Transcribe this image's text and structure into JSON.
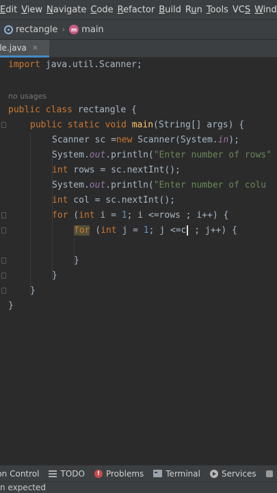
{
  "menu": {
    "items": [
      {
        "prefix": "",
        "u": "E",
        "rest": "dit"
      },
      {
        "prefix": "",
        "u": "V",
        "rest": "iew"
      },
      {
        "prefix": "",
        "u": "N",
        "rest": "avigate"
      },
      {
        "prefix": "",
        "u": "C",
        "rest": "ode"
      },
      {
        "prefix": "",
        "u": "R",
        "rest": "efactor"
      },
      {
        "prefix": "",
        "u": "B",
        "rest": "uild"
      },
      {
        "prefix": "R",
        "u": "u",
        "rest": "n"
      },
      {
        "prefix": "",
        "u": "T",
        "rest": "ools"
      },
      {
        "prefix": "VC",
        "u": "S",
        "rest": ""
      },
      {
        "prefix": "",
        "u": "W",
        "rest": "ind"
      }
    ]
  },
  "navbar": {
    "project": "rectangle",
    "branch": "main",
    "branch_badge": "m"
  },
  "tab": {
    "label": "ngle.java",
    "close": "×"
  },
  "editor": {
    "usage_hint": "no usages",
    "lines": {
      "import_kw": "import",
      "import_rest": " java.util.Scanner;",
      "l_class_public": "public",
      "l_class_class": " class",
      "l_class_rest": " rectangle {",
      "l_main_mods": "public static void",
      "l_main_name": " main",
      "l_main_rest": "(String[] args) {",
      "l_scan_a": "Scanner sc =",
      "l_scan_new": "new",
      "l_scan_b": " Scanner(System.",
      "l_scan_in": "in",
      "l_scan_c": ");",
      "l_p1_a": "System.",
      "l_p1_out": "out",
      "l_p1_b": ".println(",
      "l_p1_str": "\"Enter number of rows\"",
      "l_rows_int": "int",
      "l_rows_rest": " rows = sc.nextInt();",
      "l_p2_a": "System.",
      "l_p2_out": "out",
      "l_p2_b": ".println(",
      "l_p2_str": "\"Enter number of colu",
      "l_col_int": "int",
      "l_col_rest": " col = sc.nextInt();",
      "l_for1_for": "for",
      "l_for1_a": " (",
      "l_for1_int": "int",
      "l_for1_b": " i = ",
      "l_for1_num": "1",
      "l_for1_c": "; i <=rows ; i++) {",
      "l_for2_for": "for",
      "l_for2_a": " (",
      "l_for2_int": "int",
      "l_for2_b": " j = ",
      "l_for2_num": "1",
      "l_for2_c": "; j <=c",
      "l_for2_d": " ; j++) {",
      "close_brace": "}"
    }
  },
  "toolwindows": {
    "version_control": "ion Control",
    "todo": "TODO",
    "problems": "Problems",
    "terminal": "Terminal",
    "services": "Services"
  },
  "status": {
    "message": "n expected"
  },
  "colors": {
    "keyword": "#cc7832",
    "function": "#ffc66d",
    "string": "#6a8759",
    "field": "#9876aa",
    "number": "#6897bb",
    "text": "#a9b7c6",
    "background": "#2b2b2b"
  }
}
